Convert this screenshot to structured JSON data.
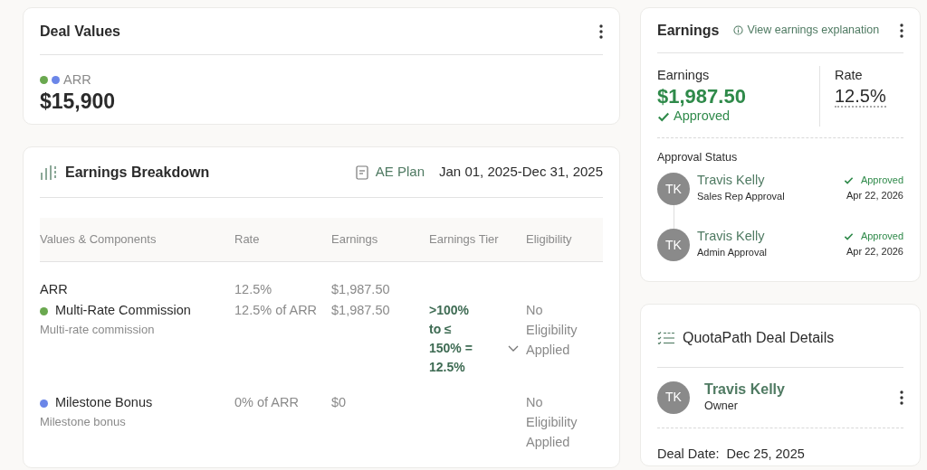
{
  "deal_values": {
    "title": "Deal Values",
    "legend": [
      {
        "color": "#6aa84f"
      },
      {
        "color": "#6b86e8"
      }
    ],
    "label": "ARR",
    "value": "$15,900"
  },
  "breakdown": {
    "title": "Earnings Breakdown",
    "plan": "AE Plan",
    "date_range": "Jan 01, 2025-Dec 31, 2025",
    "columns": [
      "Values & Components",
      "Rate",
      "Earnings",
      "Earnings Tier",
      "Eligibility"
    ],
    "rows": [
      {
        "kind": "value",
        "name": "ARR",
        "rate": "12.5%",
        "earnings": "$1,987.50"
      },
      {
        "kind": "component",
        "name": "Multi-Rate Commission",
        "color": "#6aa84f",
        "description": "Multi-rate commission",
        "rate": "12.5% of ARR",
        "earnings": "$1,987.50",
        "tier": ">100% to ≤ 150% = 12.5%",
        "expandable": true,
        "eligibility": "No Eligibility Applied"
      },
      {
        "kind": "component",
        "name": "Milestone Bonus",
        "color": "#6b86e8",
        "description": "Milestone bonus",
        "rate": "0% of ARR",
        "earnings": "$0",
        "expandable": false,
        "eligibility": "No Eligibility Applied"
      }
    ]
  },
  "earnings": {
    "title": "Earnings",
    "explanation_link": "View earnings explanation",
    "earnings_label": "Earnings",
    "earnings_value": "$1,987.50",
    "status": "Approved",
    "rate_label": "Rate",
    "rate_value": "12.5%",
    "approval_title": "Approval Status",
    "approvals": [
      {
        "initials": "TK",
        "name": "Travis Kelly",
        "role": "Sales Rep Approval",
        "status": "Approved",
        "date": "Apr 22, 2026"
      },
      {
        "initials": "TK",
        "name": "Travis Kelly",
        "role": "Admin Approval",
        "status": "Approved",
        "date": "Apr 22, 2026"
      }
    ]
  },
  "deal_details": {
    "title": "QuotaPath Deal Details",
    "owner": {
      "initials": "TK",
      "name": "Travis Kelly",
      "role": "Owner"
    },
    "deal_date_label": "Deal Date:",
    "deal_date": "Dec 25, 2025"
  }
}
